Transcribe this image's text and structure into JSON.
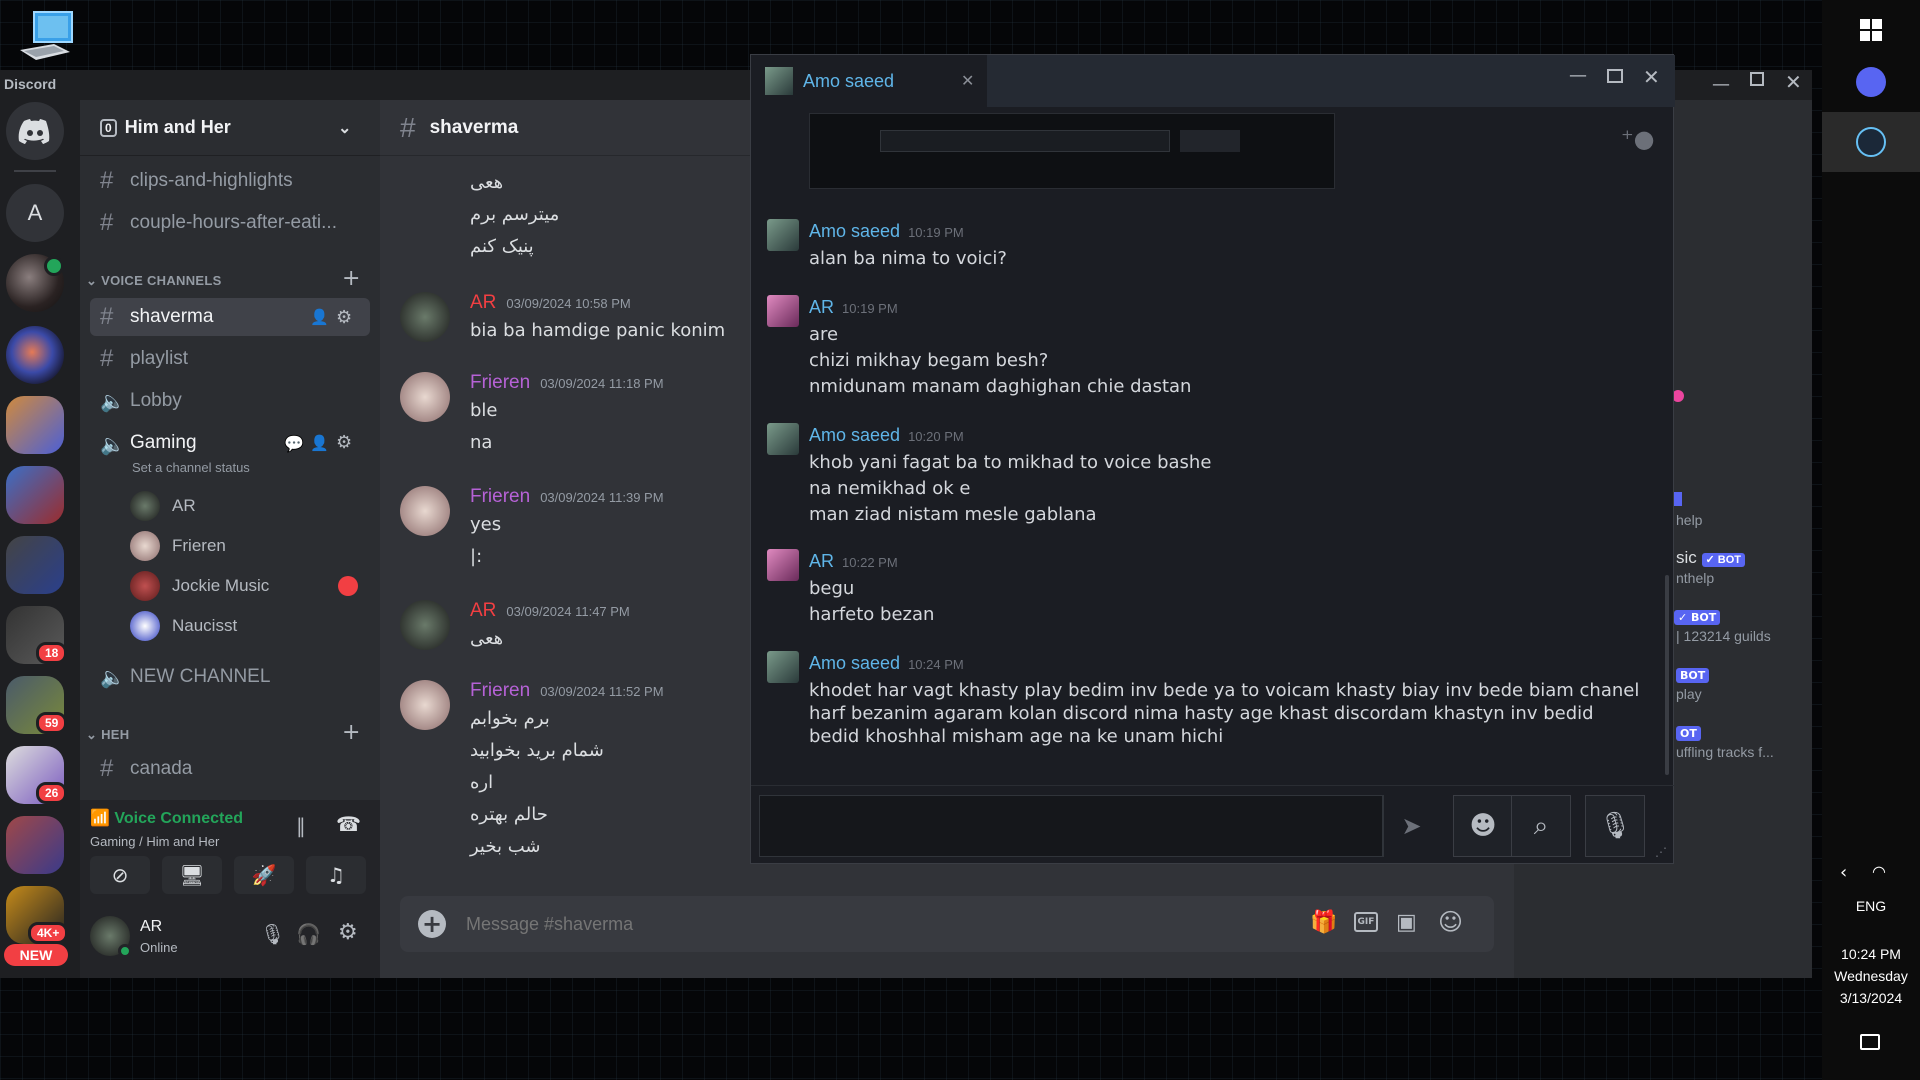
{
  "desktop": {
    "discord_label": "Discord"
  },
  "taskbar": {
    "lang": "ENG",
    "time": "10:24 PM",
    "day": "Wednesday",
    "date": "3/13/2024"
  },
  "servers": {
    "home_letter": "A",
    "badges": [
      "18",
      "59",
      "26",
      "4K+"
    ],
    "new_label": "NEW"
  },
  "sidebar": {
    "server_count": "0",
    "server_name": "Him and Her",
    "channels_top": [
      "clips-and-highlights",
      "couple-hours-after-eati..."
    ],
    "voice_category": "VOICE CHANNELS",
    "voice_channels": [
      "shaverma",
      "playlist",
      "Lobby",
      "Gaming"
    ],
    "gaming_status": "Set a channel status",
    "voice_users": [
      "AR",
      "Frieren",
      "Jockie Music",
      "Naucisst"
    ],
    "new_channel": "NEW CHANNEL",
    "heh_category": "HEH",
    "heh_channel": "canada",
    "voice_connected": "Voice Connected",
    "voice_location": "Gaming / Him and Her",
    "user_name": "AR",
    "user_status": "Online"
  },
  "chat": {
    "channel": "shaverma",
    "top_lines": [
      "هعی",
      "میترسم برم",
      "پنیک کنم"
    ],
    "messages": [
      {
        "author": "AR",
        "time": "03/09/2024 10:58 PM",
        "lines": [
          "bia ba hamdige panic konim"
        ]
      },
      {
        "author": "Frieren",
        "time": "03/09/2024 11:18 PM",
        "lines": [
          "ble",
          "na"
        ]
      },
      {
        "author": "Frieren",
        "time": "03/09/2024 11:39 PM",
        "lines": [
          "yes",
          "|:"
        ]
      },
      {
        "author": "AR",
        "time": "03/09/2024 11:47 PM",
        "lines": [
          "هعی"
        ]
      },
      {
        "author": "Frieren",
        "time": "03/09/2024 11:52 PM",
        "lines": [
          "برم بخوابم",
          "شمام برید بخوابید",
          "اره",
          "حالم بهتره",
          "شب بخیر"
        ]
      }
    ],
    "placeholder": "Message #shaverma"
  },
  "members_fragments": {
    "m1": "help",
    "m2_name": "sic",
    "m2_sub": "nthelp",
    "m3_sub": "| 123214 guilds",
    "m4_sub": "play",
    "m5_sub": "uffling tracks f...",
    "bot": "BOT",
    "bot_check": "✓ BOT",
    "bot_frag": "OT"
  },
  "overlay": {
    "tab_title": "Amo saeed",
    "messages": [
      {
        "author": "Amo saeed",
        "time": "10:19 PM",
        "lines": [
          "alan ba nima to voici?"
        ]
      },
      {
        "author": "AR",
        "time": "10:19 PM",
        "lines": [
          "are",
          "chizi mikhay begam besh?",
          "nmidunam manam daghighan chie dastan"
        ]
      },
      {
        "author": "Amo saeed",
        "time": "10:20 PM",
        "lines": [
          "khob yani fagat ba to mikhad to voice bashe",
          "na nemikhad ok e",
          "man ziad nistam mesle gablana"
        ]
      },
      {
        "author": "AR",
        "time": "10:22 PM",
        "lines": [
          "begu",
          "harfeto bezan"
        ]
      },
      {
        "author": "Amo saeed",
        "time": "10:24 PM",
        "lines": [
          "khodet har vagt khasty play bedim inv bede ya to voicam khasty biay inv bede biam chanel harf bezanim agaram kolan discord nima hasty age khast discordam khastyn inv bedid bedid khoshhal misham age na ke unam hichi"
        ]
      }
    ]
  },
  "colors": {
    "ar_red": "#f23f42",
    "frieren_purple": "#b662d6",
    "overlay_blue": "#5fb5e8",
    "voice_green": "#23a55a"
  }
}
